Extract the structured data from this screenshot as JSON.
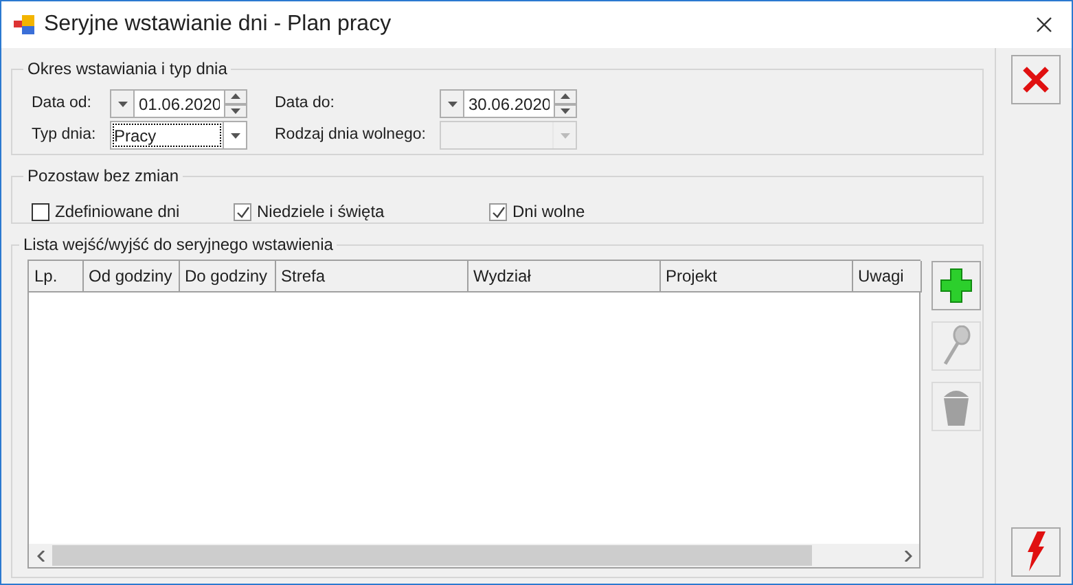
{
  "window": {
    "title": "Seryjne wstawianie dni - Plan pracy"
  },
  "period_group": {
    "title": "Okres wstawiania i typ dnia",
    "date_from": {
      "label": "Data od:",
      "value": "01.06.2020"
    },
    "date_to": {
      "label": "Data do:",
      "value": "30.06.2020"
    },
    "day_type": {
      "label": "Typ dnia:",
      "value": "Pracy",
      "focused": true,
      "disabled": false
    },
    "day_off_kind": {
      "label": "Rodzaj dnia wolnego:",
      "focused": false,
      "disabled": true
    }
  },
  "keep_group": {
    "title": "Pozostaw bez zmian",
    "checkboxes": [
      {
        "label": "Zdefiniowane dni",
        "checked": false
      },
      {
        "label": "Niedziele i święta",
        "checked": true
      },
      {
        "label": "Dni wolne",
        "checked": true
      }
    ]
  },
  "list_group": {
    "title": "Lista wejść/wyjść do seryjnego wstawienia",
    "table": {
      "columns": [
        "Lp.",
        "Od godziny",
        "Do godziny",
        "Strefa",
        "Wydział",
        "Projekt",
        "Uwagi"
      ]
    },
    "side_buttons": [
      {
        "kind": "add",
        "disabled": false
      },
      {
        "kind": "search",
        "disabled": true
      },
      {
        "kind": "delete",
        "disabled": true
      }
    ]
  },
  "right_buttons": [
    {
      "kind": "cancel"
    },
    {
      "kind": "run"
    }
  ]
}
